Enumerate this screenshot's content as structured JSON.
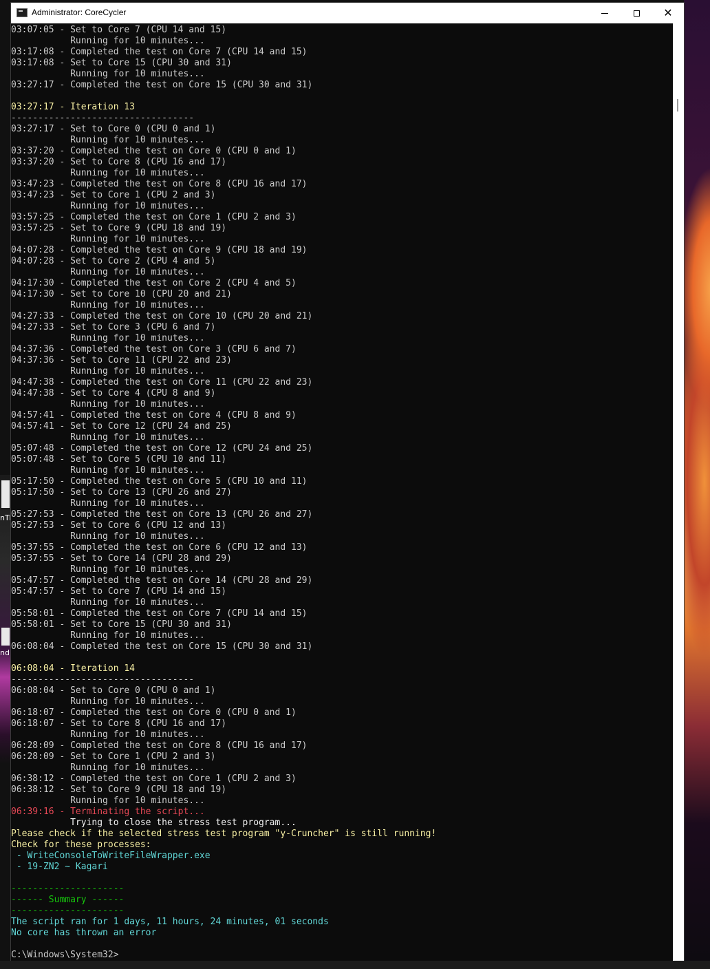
{
  "window": {
    "title": "Administrator: CoreCycler"
  },
  "caption_buttons": {
    "minimize": "minimize",
    "maximize": "maximize",
    "close": "✕"
  },
  "colors": {
    "normal": "#cccccc",
    "yellow": "#f9f1a5",
    "red": "#e74856",
    "cyan": "#61d6d6",
    "green": "#16c60c"
  },
  "left_fragments": [
    "nTi",
    "nd"
  ],
  "console_lines": [
    {
      "text": "03:07:05 - Set to Core 7 (CPU 14 and 15)",
      "color": "normal"
    },
    {
      "text": "           Running for 10 minutes...",
      "color": "normal"
    },
    {
      "text": "03:17:08 - Completed the test on Core 7 (CPU 14 and 15)",
      "color": "normal"
    },
    {
      "text": "03:17:08 - Set to Core 15 (CPU 30 and 31)",
      "color": "normal"
    },
    {
      "text": "           Running for 10 minutes...",
      "color": "normal"
    },
    {
      "text": "03:27:17 - Completed the test on Core 15 (CPU 30 and 31)",
      "color": "normal"
    },
    {
      "text": "",
      "color": "normal"
    },
    {
      "text": "03:27:17 - Iteration 13",
      "color": "yellow"
    },
    {
      "text": "----------------------------------",
      "color": "normal"
    },
    {
      "text": "03:27:17 - Set to Core 0 (CPU 0 and 1)",
      "color": "normal"
    },
    {
      "text": "           Running for 10 minutes...",
      "color": "normal"
    },
    {
      "text": "03:37:20 - Completed the test on Core 0 (CPU 0 and 1)",
      "color": "normal"
    },
    {
      "text": "03:37:20 - Set to Core 8 (CPU 16 and 17)",
      "color": "normal"
    },
    {
      "text": "           Running for 10 minutes...",
      "color": "normal"
    },
    {
      "text": "03:47:23 - Completed the test on Core 8 (CPU 16 and 17)",
      "color": "normal"
    },
    {
      "text": "03:47:23 - Set to Core 1 (CPU 2 and 3)",
      "color": "normal"
    },
    {
      "text": "           Running for 10 minutes...",
      "color": "normal"
    },
    {
      "text": "03:57:25 - Completed the test on Core 1 (CPU 2 and 3)",
      "color": "normal"
    },
    {
      "text": "03:57:25 - Set to Core 9 (CPU 18 and 19)",
      "color": "normal"
    },
    {
      "text": "           Running for 10 minutes...",
      "color": "normal"
    },
    {
      "text": "04:07:28 - Completed the test on Core 9 (CPU 18 and 19)",
      "color": "normal"
    },
    {
      "text": "04:07:28 - Set to Core 2 (CPU 4 and 5)",
      "color": "normal"
    },
    {
      "text": "           Running for 10 minutes...",
      "color": "normal"
    },
    {
      "text": "04:17:30 - Completed the test on Core 2 (CPU 4 and 5)",
      "color": "normal"
    },
    {
      "text": "04:17:30 - Set to Core 10 (CPU 20 and 21)",
      "color": "normal"
    },
    {
      "text": "           Running for 10 minutes...",
      "color": "normal"
    },
    {
      "text": "04:27:33 - Completed the test on Core 10 (CPU 20 and 21)",
      "color": "normal"
    },
    {
      "text": "04:27:33 - Set to Core 3 (CPU 6 and 7)",
      "color": "normal"
    },
    {
      "text": "           Running for 10 minutes...",
      "color": "normal"
    },
    {
      "text": "04:37:36 - Completed the test on Core 3 (CPU 6 and 7)",
      "color": "normal"
    },
    {
      "text": "04:37:36 - Set to Core 11 (CPU 22 and 23)",
      "color": "normal"
    },
    {
      "text": "           Running for 10 minutes...",
      "color": "normal"
    },
    {
      "text": "04:47:38 - Completed the test on Core 11 (CPU 22 and 23)",
      "color": "normal"
    },
    {
      "text": "04:47:38 - Set to Core 4 (CPU 8 and 9)",
      "color": "normal"
    },
    {
      "text": "           Running for 10 minutes...",
      "color": "normal"
    },
    {
      "text": "04:57:41 - Completed the test on Core 4 (CPU 8 and 9)",
      "color": "normal"
    },
    {
      "text": "04:57:41 - Set to Core 12 (CPU 24 and 25)",
      "color": "normal"
    },
    {
      "text": "           Running for 10 minutes...",
      "color": "normal"
    },
    {
      "text": "05:07:48 - Completed the test on Core 12 (CPU 24 and 25)",
      "color": "normal"
    },
    {
      "text": "05:07:48 - Set to Core 5 (CPU 10 and 11)",
      "color": "normal"
    },
    {
      "text": "           Running for 10 minutes...",
      "color": "normal"
    },
    {
      "text": "05:17:50 - Completed the test on Core 5 (CPU 10 and 11)",
      "color": "normal"
    },
    {
      "text": "05:17:50 - Set to Core 13 (CPU 26 and 27)",
      "color": "normal"
    },
    {
      "text": "           Running for 10 minutes...",
      "color": "normal"
    },
    {
      "text": "05:27:53 - Completed the test on Core 13 (CPU 26 and 27)",
      "color": "normal"
    },
    {
      "text": "05:27:53 - Set to Core 6 (CPU 12 and 13)",
      "color": "normal"
    },
    {
      "text": "           Running for 10 minutes...",
      "color": "normal"
    },
    {
      "text": "05:37:55 - Completed the test on Core 6 (CPU 12 and 13)",
      "color": "normal"
    },
    {
      "text": "05:37:55 - Set to Core 14 (CPU 28 and 29)",
      "color": "normal"
    },
    {
      "text": "           Running for 10 minutes...",
      "color": "normal"
    },
    {
      "text": "05:47:57 - Completed the test on Core 14 (CPU 28 and 29)",
      "color": "normal"
    },
    {
      "text": "05:47:57 - Set to Core 7 (CPU 14 and 15)",
      "color": "normal"
    },
    {
      "text": "           Running for 10 minutes...",
      "color": "normal"
    },
    {
      "text": "05:58:01 - Completed the test on Core 7 (CPU 14 and 15)",
      "color": "normal"
    },
    {
      "text": "05:58:01 - Set to Core 15 (CPU 30 and 31)",
      "color": "normal"
    },
    {
      "text": "           Running for 10 minutes...",
      "color": "normal"
    },
    {
      "text": "06:08:04 - Completed the test on Core 15 (CPU 30 and 31)",
      "color": "normal"
    },
    {
      "text": "",
      "color": "normal"
    },
    {
      "text": "06:08:04 - Iteration 14",
      "color": "yellow"
    },
    {
      "text": "----------------------------------",
      "color": "normal"
    },
    {
      "text": "06:08:04 - Set to Core 0 (CPU 0 and 1)",
      "color": "normal"
    },
    {
      "text": "           Running for 10 minutes...",
      "color": "normal"
    },
    {
      "text": "06:18:07 - Completed the test on Core 0 (CPU 0 and 1)",
      "color": "normal"
    },
    {
      "text": "06:18:07 - Set to Core 8 (CPU 16 and 17)",
      "color": "normal"
    },
    {
      "text": "           Running for 10 minutes...",
      "color": "normal"
    },
    {
      "text": "06:28:09 - Completed the test on Core 8 (CPU 16 and 17)",
      "color": "normal"
    },
    {
      "text": "06:28:09 - Set to Core 1 (CPU 2 and 3)",
      "color": "normal"
    },
    {
      "text": "           Running for 10 minutes...",
      "color": "normal"
    },
    {
      "text": "06:38:12 - Completed the test on Core 1 (CPU 2 and 3)",
      "color": "normal"
    },
    {
      "text": "06:38:12 - Set to Core 9 (CPU 18 and 19)",
      "color": "normal"
    },
    {
      "text": "           Running for 10 minutes...",
      "color": "normal"
    },
    {
      "text": "06:39:16 - Terminating the script...",
      "color": "red"
    },
    {
      "text": "           Trying to close the stress test program...",
      "color": "white"
    },
    {
      "text": "Please check if the selected stress test program \"y-Cruncher\" is still running!",
      "color": "yellow"
    },
    {
      "text": "Check for these processes:",
      "color": "yellow"
    },
    {
      "text": " - WriteConsoleToWriteFileWrapper.exe",
      "color": "cyan"
    },
    {
      "text": " - 19-ZN2 ~ Kagari",
      "color": "cyan"
    },
    {
      "text": "",
      "color": "normal"
    },
    {
      "text": "---------------------",
      "color": "green"
    },
    {
      "text": "------ Summary ------",
      "color": "green"
    },
    {
      "text": "---------------------",
      "color": "green"
    },
    {
      "text": "The script ran for 1 days, 11 hours, 24 minutes, 01 seconds",
      "color": "cyan"
    },
    {
      "text": "No core has thrown an error",
      "color": "cyan"
    },
    {
      "text": "",
      "color": "normal"
    },
    {
      "text": "C:\\Windows\\System32>",
      "color": "normal"
    }
  ]
}
